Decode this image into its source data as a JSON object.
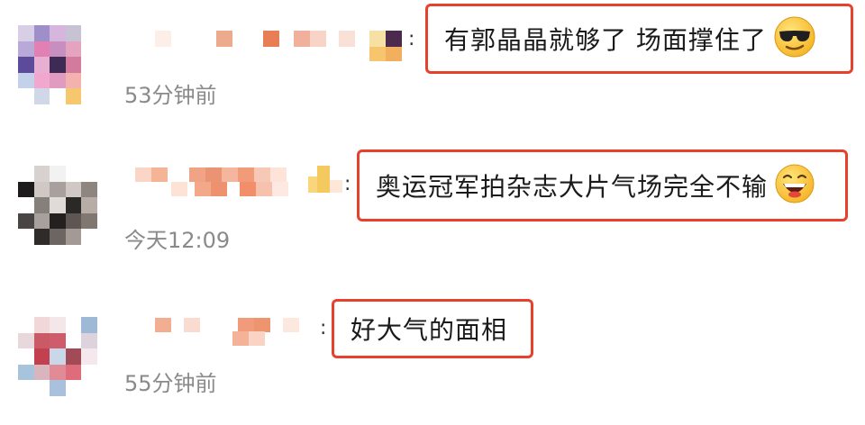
{
  "comments": [
    {
      "text": "有郭晶晶就够了 场面撑住了",
      "colon": ":",
      "time": "53分钟前",
      "emoji": "sunglasses-face"
    },
    {
      "text": "奥运冠军拍杂志大片气场完全不输",
      "colon": ":",
      "time": "今天12:09",
      "emoji": "grinning-face"
    },
    {
      "text": "好大气的面相",
      "colon": ":",
      "time": "55分钟前",
      "emoji": ""
    }
  ],
  "colors": {
    "highlight_border": "#e5412c",
    "timestamp": "#8a8a8a",
    "text": "#1a1a1a"
  }
}
